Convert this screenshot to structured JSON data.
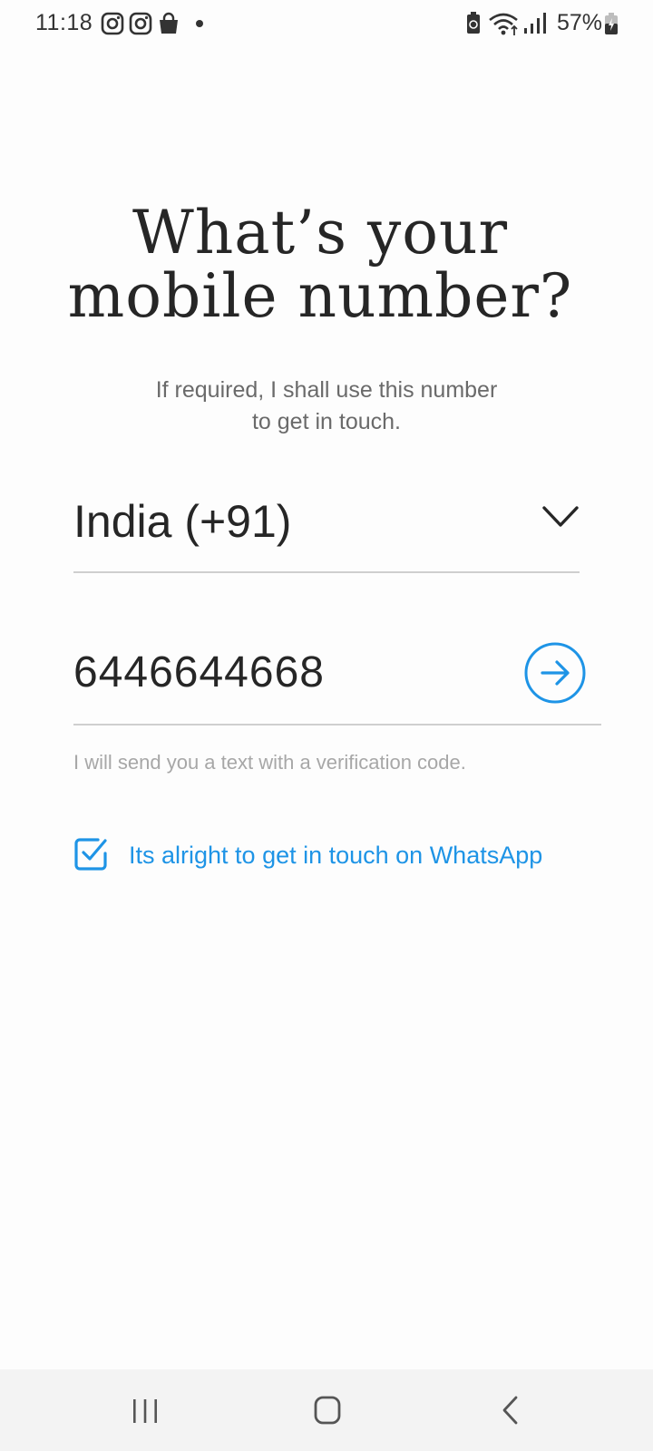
{
  "status_bar": {
    "time": "11:18",
    "left_icons": [
      "instagram-icon",
      "instagram-icon",
      "shopping-bag-icon",
      "notification-dot"
    ],
    "right_icons": [
      "battery-saver-icon",
      "wifi-icon",
      "signal-icon"
    ],
    "battery": "57%"
  },
  "heading": {
    "line1": "What’s your",
    "line2": "mobile number?"
  },
  "subtitle": {
    "line1": "If required, I shall use this number",
    "line2": "to get in touch."
  },
  "country_select": {
    "value": "India (+91)"
  },
  "phone": {
    "value": "6446644668"
  },
  "hint": "I will send you a text with a verification code.",
  "whatsapp_consent": {
    "label": "Its alright to get in touch on WhatsApp",
    "checked": true
  },
  "colors": {
    "accent": "#1e94e6",
    "text": "#262626",
    "muted": "#a7a7a7",
    "background": "#fdfdfd"
  },
  "nav_bar": {
    "buttons": [
      "recent-apps-icon",
      "home-icon",
      "back-icon"
    ]
  }
}
